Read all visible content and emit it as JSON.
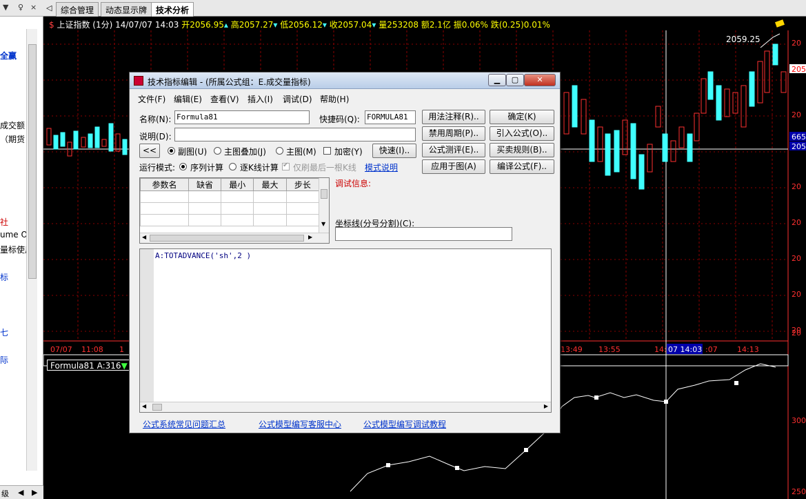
{
  "left_panel": {
    "top_icons": [
      "▼",
      "♀",
      "×"
    ],
    "items": [
      {
        "text": "全赢",
        "color": "#0033cc"
      },
      {
        "text": "成交额",
        "color": "#000"
      },
      {
        "text": "（期货",
        "color": "#000"
      },
      {
        "text": "社",
        "color": "#cc0000"
      },
      {
        "text": "ume Os",
        "color": "#000"
      },
      {
        "text": "量标使用",
        "color": "#000"
      },
      {
        "text": "标",
        "color": "#0033cc"
      },
      {
        "text": "七",
        "color": "#0033cc"
      },
      {
        "text": "际",
        "color": "#0033cc"
      }
    ],
    "bottom_text": "级"
  },
  "tabs": {
    "arrow": "◁",
    "items": [
      {
        "label": "综合管理"
      },
      {
        "label": "动态显示牌"
      },
      {
        "label": "技术分析",
        "active": true
      }
    ]
  },
  "chart": {
    "index_symbol": "$",
    "index_name": "上证指数 (1分)",
    "datetime": "14/07/07 14:03",
    "open": "开2056.95",
    "high": "高2057.27",
    "low": "低2056.12",
    "close": "收2057.04",
    "volume": "量253208",
    "amount": "额2.1亿",
    "amplitude": "振0.06%",
    "change": "跌(0.25)0.01%",
    "price_label": "2059.25",
    "right_prices": [
      "20",
      "205",
      "20",
      "20",
      "665",
      "205",
      "20",
      "20",
      "20",
      "20",
      "20",
      "20"
    ],
    "time_labels": [
      "07/07",
      "11:08",
      "1",
      "13:49",
      "13:55",
      "14:",
      "07 14:03",
      ":07",
      "14:13"
    ],
    "indicator_label": "Formula81 A:316",
    "right_indicator": [
      "300",
      "250"
    ],
    "colors": {
      "up": "#ff3030",
      "down": "#40ffff",
      "grid": "#8b0000",
      "axis": "#ff3030"
    }
  },
  "dialog": {
    "title": "技术指标编辑 - (所属公式组：E.成交量指标)",
    "menu": [
      "文件(F)",
      "编辑(E)",
      "查看(V)",
      "插入(I)",
      "调试(D)",
      "帮助(H)"
    ],
    "name_label": "名称(N):",
    "name_value": "Formula81",
    "shortcut_label": "快捷码(Q):",
    "shortcut_value": "FORMULA81",
    "desc_label": "说明(D):",
    "desc_value": "",
    "collapse_button": "<<",
    "radio_sub": "副图(U)",
    "radio_overlay": "主图叠加(J)",
    "radio_main": "主图(M)",
    "encrypt_label": "加密(Y)",
    "fast_button": "快速(I)..",
    "run_mode_label": "运行模式:",
    "run_seq": "序列计算",
    "run_kline": "逐K线计算",
    "refresh_last": "仅刷最后一根K线",
    "mode_help": "模式说明",
    "buttons": {
      "usage": "用法注释(R)..",
      "confirm": "确定(K)",
      "forbid_period": "禁用周期(P)..",
      "import": "引入公式(O)..",
      "test": "公式测评(E)..",
      "trade_rule": "买卖规则(B)..",
      "apply": "应用于图(A)",
      "compile": "编译公式(F).."
    },
    "param_headers": [
      "参数名",
      "缺省",
      "最小",
      "最大",
      "步长"
    ],
    "debug_label": "调试信息:",
    "coord_label": "坐标线(分号分割)(C):",
    "coord_value": "",
    "code": "A:TOTADVANCE('sh',2 )",
    "links": [
      "公式系统常见问题汇总",
      "公式模型编写客服中心",
      "公式模型编写调试教程"
    ]
  }
}
